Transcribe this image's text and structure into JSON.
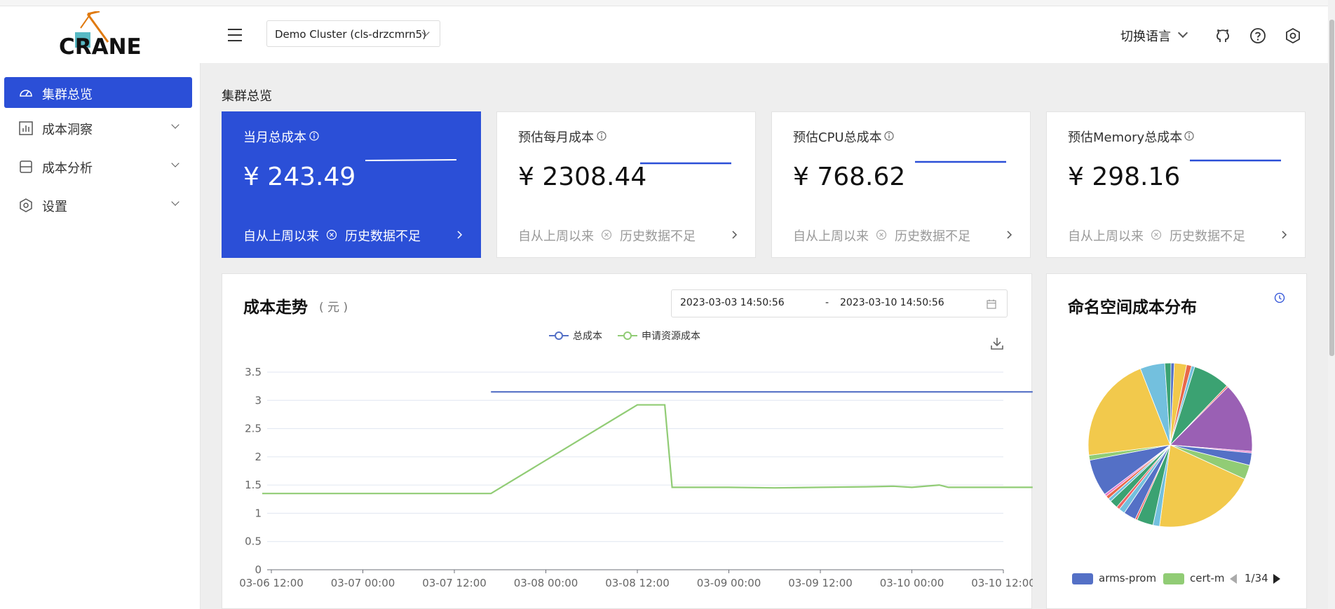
{
  "app": {
    "logo_text": "CRANE"
  },
  "header": {
    "cluster_select": "Demo Cluster (cls-drzcmrn5)",
    "language": "切换语言",
    "icons": [
      "github-icon",
      "help-icon",
      "settings-icon"
    ]
  },
  "sidebar": {
    "items": [
      {
        "label": "集群总览",
        "icon": "dashboard-icon",
        "active": true
      },
      {
        "label": "成本洞察",
        "icon": "bar-chart-icon",
        "expandable": true
      },
      {
        "label": "成本分析",
        "icon": "analysis-icon",
        "expandable": true
      },
      {
        "label": "设置",
        "icon": "settings-icon",
        "expandable": true
      }
    ]
  },
  "page": {
    "title": "集群总览"
  },
  "cards": [
    {
      "title": "当月总成本",
      "value": "¥ 243.49",
      "since": "自从上周以来",
      "status": "历史数据不足"
    },
    {
      "title": "预估每月成本",
      "value": "¥ 2308.44",
      "since": "自从上周以来",
      "status": "历史数据不足"
    },
    {
      "title": "预估CPU总成本",
      "value": "¥ 768.62",
      "since": "自从上周以来",
      "status": "历史数据不足"
    },
    {
      "title": "预估Memory总成本",
      "value": "¥ 298.16",
      "since": "自从上周以来",
      "status": "历史数据不足"
    }
  ],
  "trend": {
    "title": "成本走势",
    "unit": "( 元 )",
    "date_start": "2023-03-03 14:50:56",
    "date_sep": "-",
    "date_end": "2023-03-10 14:50:56"
  },
  "chart_data": {
    "type": "line",
    "x": [
      "03-06 12:00",
      "03-07 00:00",
      "03-07 12:00",
      "03-08 00:00",
      "03-08 12:00",
      "03-09 00:00",
      "03-09 12:00",
      "03-10 00:00",
      "03-10 12:00"
    ],
    "ylim": [
      0,
      3.5
    ],
    "yticks": [
      "0",
      "0.5",
      "1",
      "1.5",
      "2",
      "2.5",
      "3",
      "3.5"
    ],
    "series": [
      {
        "name": "总成本",
        "color": "#5470c6",
        "points": [
          [
            2.4,
            3.15
          ],
          [
            8.32,
            3.15
          ]
        ]
      },
      {
        "name": "申请资源成本",
        "color": "#91cc75",
        "points": [
          [
            -0.1,
            1.35
          ],
          [
            2.4,
            1.35
          ],
          [
            4.0,
            2.92
          ],
          [
            4.3,
            2.92
          ],
          [
            4.38,
            1.46
          ],
          [
            5.0,
            1.46
          ],
          [
            5.5,
            1.45
          ],
          [
            6.0,
            1.46
          ],
          [
            6.5,
            1.47
          ],
          [
            6.8,
            1.48
          ],
          [
            7.0,
            1.46
          ],
          [
            7.3,
            1.5
          ],
          [
            7.4,
            1.46
          ],
          [
            8.0,
            1.46
          ],
          [
            8.32,
            1.46
          ]
        ]
      }
    ],
    "grid": true,
    "legend": "top-center"
  },
  "pie": {
    "title": "命名空间成本分布",
    "legend": [
      {
        "name": "arms-prom",
        "color": "#5470c6"
      },
      {
        "name": "cert-m",
        "color": "#91cc75"
      }
    ],
    "page": "1/34",
    "slices": [
      {
        "value": 3.0,
        "color": "#f2c94c"
      },
      {
        "value": 1.2,
        "color": "#e8684a"
      },
      {
        "value": 0.8,
        "color": "#73c0de"
      },
      {
        "value": 9.0,
        "color": "#3ba272"
      },
      {
        "value": 0.4,
        "color": "#ee6666"
      },
      {
        "value": 17.0,
        "color": "#9a60b4"
      },
      {
        "value": 0.4,
        "color": "#ea7ccc"
      },
      {
        "value": 3.0,
        "color": "#5470c6"
      },
      {
        "value": 3.5,
        "color": "#91cc75"
      },
      {
        "value": 25.0,
        "color": "#f2c94c"
      },
      {
        "value": 1.6,
        "color": "#73c0de"
      },
      {
        "value": 4.0,
        "color": "#3ba272"
      },
      {
        "value": 0.5,
        "color": "#ee6666"
      },
      {
        "value": 3.0,
        "color": "#5470c6"
      },
      {
        "value": 1.5,
        "color": "#73c0de"
      },
      {
        "value": 0.8,
        "color": "#ee6666"
      },
      {
        "value": 2.0,
        "color": "#3ba272"
      },
      {
        "value": 0.8,
        "color": "#73c0de"
      },
      {
        "value": 0.8,
        "color": "#e8684a"
      },
      {
        "value": 0.6,
        "color": "#ea7ccc"
      },
      {
        "value": 9.0,
        "color": "#5470c6"
      },
      {
        "value": 1.2,
        "color": "#91cc75"
      },
      {
        "value": 26.0,
        "color": "#f2c94c"
      },
      {
        "value": 6.0,
        "color": "#73c0de"
      },
      {
        "value": 1.5,
        "color": "#3ba272"
      },
      {
        "value": 0.8,
        "color": "#5470c6"
      }
    ]
  }
}
